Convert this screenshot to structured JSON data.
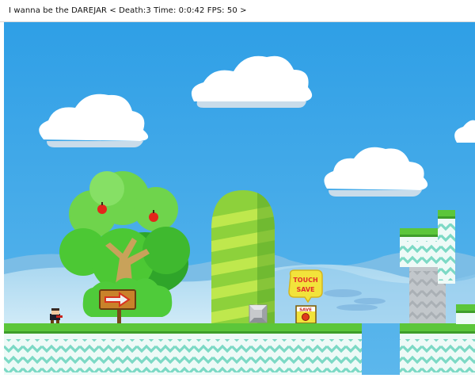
{
  "window": {
    "title": "I wanna be the DAREJAR < Death:3 Time: 0:0:42 FPS: 50 >"
  },
  "hud": {
    "death_count": 3,
    "time": "0:0:42",
    "fps": 50
  },
  "signs": {
    "touch_save_line1": "TOUCH",
    "touch_save_line2": "SAVE",
    "save_point_label": "SAVE"
  },
  "colors": {
    "sky": "#39a3e4",
    "grass": "#5cc63a",
    "ground_base": "#eefaf7",
    "wave": "#7cd9c5",
    "pillar_gray": "#c2c7cb",
    "save_red": "#e03a1a",
    "sign_yellow": "#f2e33b"
  }
}
